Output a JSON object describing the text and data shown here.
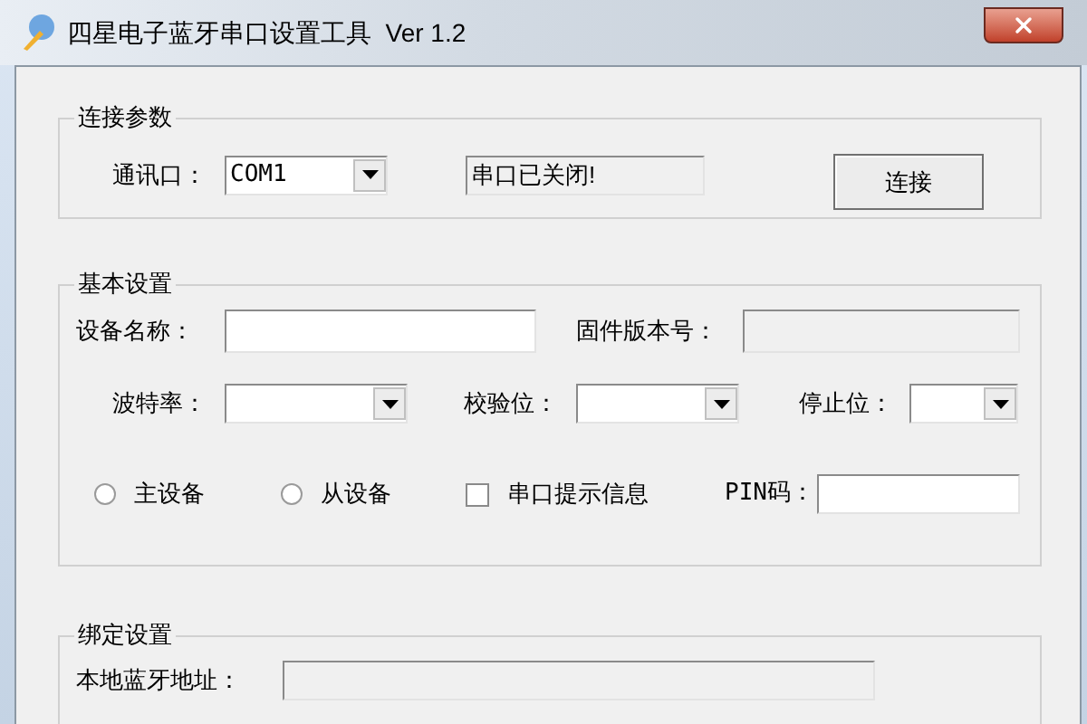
{
  "window": {
    "title": "四星电子蓝牙串口设置工具  Ver 1.2"
  },
  "connection": {
    "legend": "连接参数",
    "port_label": "通讯口：",
    "port_value": "COM1",
    "status": "串口已关闭!",
    "connect_button": "连接"
  },
  "basic": {
    "legend": "基本设置",
    "name_label": "设备名称：",
    "firmware_label": "固件版本号：",
    "firmware_disabled": true,
    "baud_label": "波特率：",
    "parity_label": "校验位：",
    "stop_label": "停止位：",
    "roles": [
      {
        "label": "主设备",
        "selected": false
      },
      {
        "label": "从设备",
        "selected": false
      }
    ],
    "serial_hint": {
      "label": "串口提示信息",
      "checked": false
    },
    "pin_label": "PIN码："
  },
  "binding": {
    "legend": "绑定设置",
    "address_label": "本地蓝牙地址：",
    "address_disabled": true
  }
}
